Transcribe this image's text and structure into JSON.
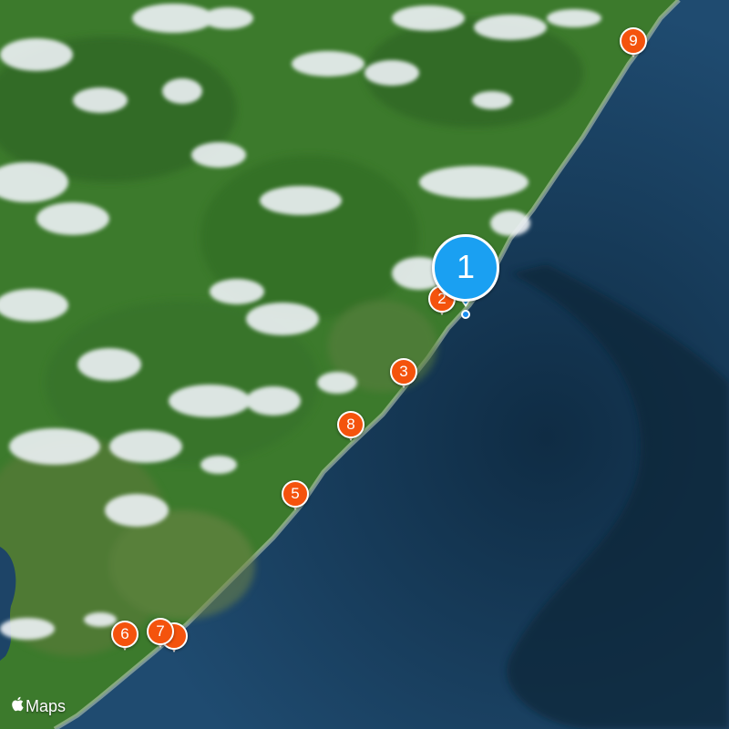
{
  "map": {
    "type": "satellite",
    "colors": {
      "ocean": "#1d4467",
      "land": "#3c7a2c",
      "pin": "#f4530d",
      "selected_pin": "#1aa0f2"
    }
  },
  "pins": [
    {
      "label": "1",
      "selected": true
    },
    {
      "label": "2"
    },
    {
      "label": "3"
    },
    {
      "label": "8"
    },
    {
      "label": "5"
    },
    {
      "label": "6"
    },
    {
      "label": "7"
    },
    {
      "label": "9"
    }
  ],
  "attribution": {
    "logo_icon": "apple-logo-icon",
    "text": "Maps"
  }
}
